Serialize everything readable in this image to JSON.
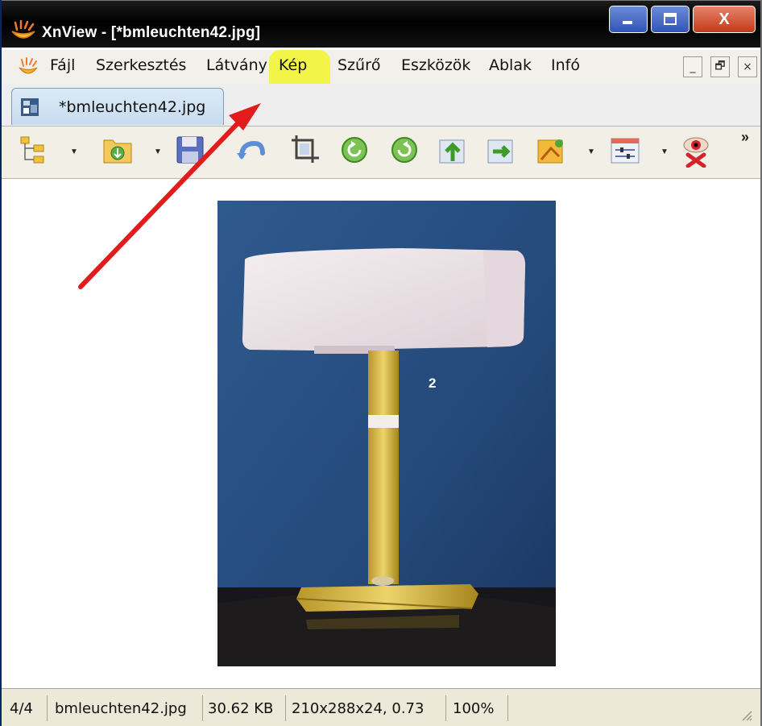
{
  "window": {
    "title": "XnView - [*bmleuchten42.jpg]",
    "buttons": {
      "minimize": "minimize",
      "maximize": "maximize",
      "close": "X"
    }
  },
  "menubar": {
    "items": [
      "Fájl",
      "Szerkesztés",
      "Látvány",
      "Kép",
      "Szűrő",
      "Eszközök",
      "Ablak",
      "Infó"
    ],
    "highlighted": "Kép",
    "mdi_buttons": [
      "_",
      "🗗",
      "×"
    ]
  },
  "tab": {
    "label": "*bmleuchten42.jpg"
  },
  "toolbar": {
    "icons": [
      "tree-view-icon",
      "open-folder-icon",
      "save-icon",
      "undo-icon",
      "crop-icon",
      "rotate-left-icon",
      "rotate-right-icon",
      "export-icon",
      "convert-icon",
      "batch-icon",
      "settings-icon",
      "red-eye-icon"
    ],
    "overflow": "»"
  },
  "image": {
    "label": "2"
  },
  "statusbar": {
    "position": "4/4",
    "filename": "bmleuchten42.jpg",
    "filesize": "30.62 KB",
    "dimensions": "210x288x24, 0.73",
    "zoom": "100%"
  },
  "annotation": {
    "arrow_color": "#e21b1b",
    "highlight_color": "#f2f53a"
  }
}
